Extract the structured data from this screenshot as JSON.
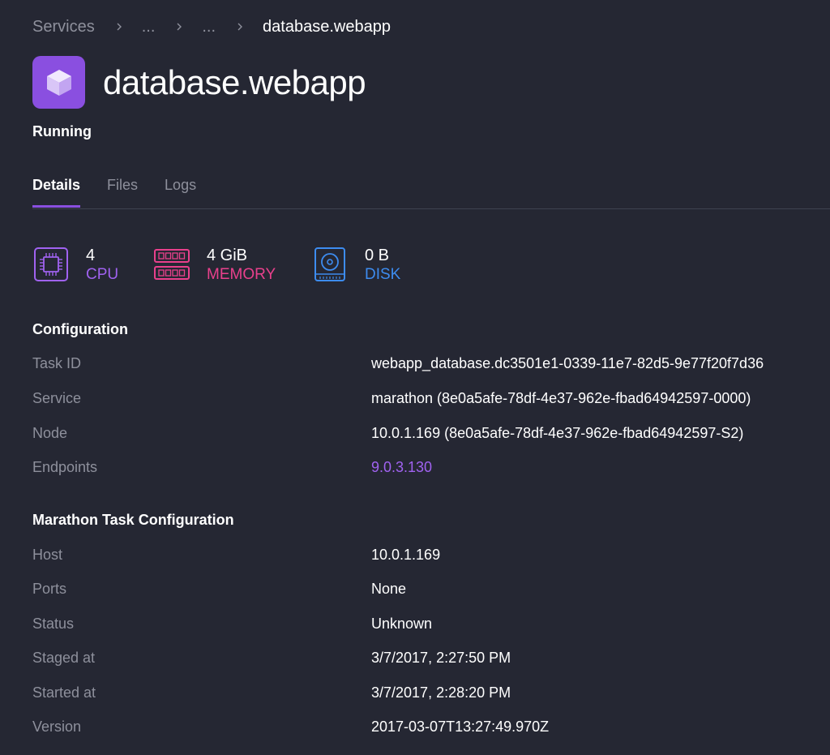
{
  "breadcrumb": {
    "items": [
      "Services",
      "...",
      "...",
      "database.webapp"
    ]
  },
  "header": {
    "title": "database.webapp",
    "status": "Running",
    "icon": "cube-icon",
    "icon_bg": "#8a4fe0"
  },
  "tabs": [
    {
      "label": "Details",
      "active": true
    },
    {
      "label": "Files",
      "active": false
    },
    {
      "label": "Logs",
      "active": false
    }
  ],
  "resources": {
    "cpu": {
      "value": "4",
      "label": "CPU",
      "color": "#a062f0",
      "icon": "cpu-icon"
    },
    "memory": {
      "value": "4 GiB",
      "label": "MEMORY",
      "color": "#e9408c",
      "icon": "memory-icon"
    },
    "disk": {
      "value": "0 B",
      "label": "DISK",
      "color": "#3d8cf0",
      "icon": "disk-icon"
    }
  },
  "configuration": {
    "title": "Configuration",
    "rows": [
      {
        "label": "Task ID",
        "value": "webapp_database.dc3501e1-0339-11e7-82d5-9e77f20f7d36"
      },
      {
        "label": "Service",
        "value": "marathon (8e0a5afe-78df-4e37-962e-fbad64942597-0000)"
      },
      {
        "label": "Node",
        "value": "10.0.1.169 (8e0a5afe-78df-4e37-962e-fbad64942597-S2)"
      },
      {
        "label": "Endpoints",
        "value": "9.0.3.130"
      }
    ]
  },
  "marathon": {
    "title": "Marathon Task Configuration",
    "rows": [
      {
        "label": "Host",
        "value": "10.0.1.169"
      },
      {
        "label": "Ports",
        "value": "None"
      },
      {
        "label": "Status",
        "value": "Unknown"
      },
      {
        "label": "Staged at",
        "value": "3/7/2017, 2:27:50 PM"
      },
      {
        "label": "Started at",
        "value": "3/7/2017, 2:28:20 PM"
      },
      {
        "label": "Version",
        "value": "2017-03-07T13:27:49.970Z"
      }
    ]
  },
  "colors": {
    "background": "#252733",
    "accent": "#8a4fe0",
    "link": "#a062f0",
    "muted_text": "#8e909c"
  }
}
